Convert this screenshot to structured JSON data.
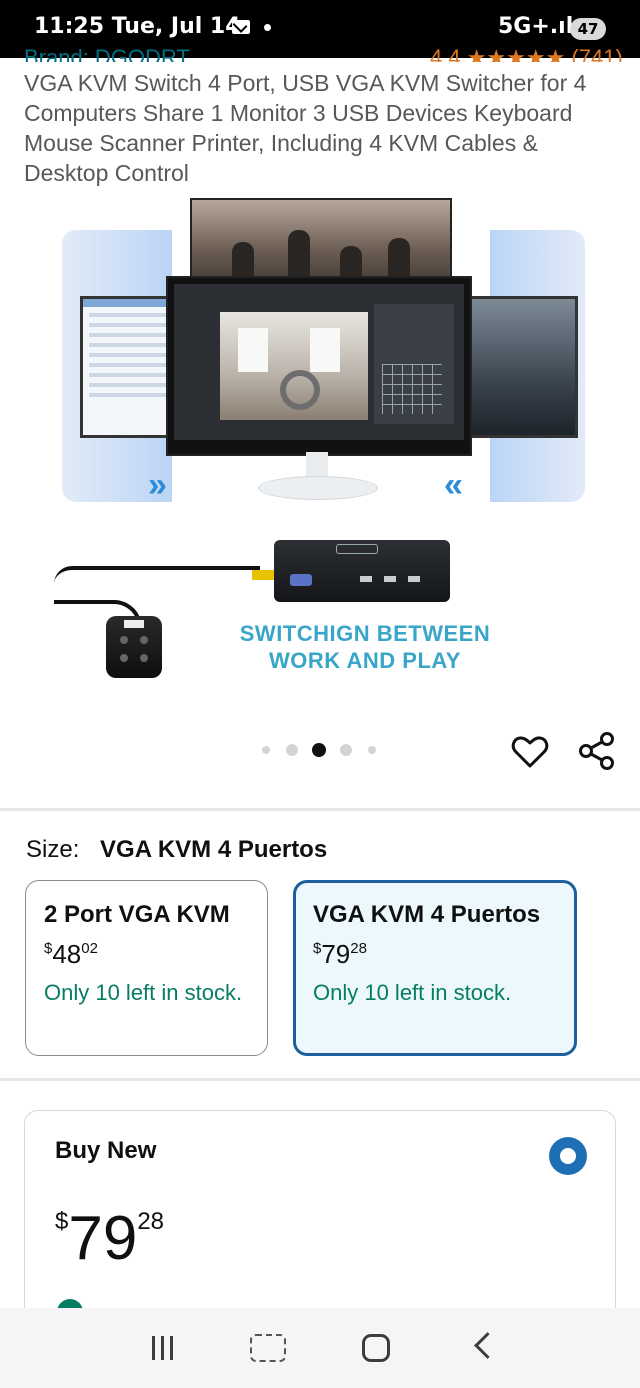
{
  "status_bar": {
    "time": "11:25 Tue, Jul 14",
    "network": "5G+.ıl",
    "battery": "47"
  },
  "header": {
    "brand_partial": "Brand: DGODRT",
    "rating_partial": "4.4 ★★★★★ (741)"
  },
  "product": {
    "title": "VGA KVM Switch 4 Port, USB VGA KVM Switcher for 4 Computers Share 1 Monitor 3 USB Devices Keyboard Mouse Scanner Printer, Including 4 KVM Cables & Desktop Control",
    "image_caption": "SWITCHIGN BETWEEN\nWORK AND PLAY",
    "image_count": 5,
    "active_image_index": 2
  },
  "icons": {
    "wishlist": "heart-icon",
    "share": "share-icon"
  },
  "size": {
    "label": "Size:",
    "selected": "VGA KVM 4 Puertos",
    "options": [
      {
        "name": "2 Port VGA KVM",
        "currency": "$",
        "whole": "48",
        "fraction": "02",
        "stock": "Only 10 left in stock."
      },
      {
        "name": "VGA KVM 4 Puertos",
        "currency": "$",
        "whole": "79",
        "fraction": "28",
        "stock": "Only 10 left in stock."
      }
    ]
  },
  "buy_new": {
    "title": "Buy New",
    "currency": "$",
    "whole": "79",
    "fraction": "28"
  },
  "colors": {
    "accent_blue": "#1f5e9e",
    "stock_green": "#067d62",
    "caption_teal": "#39a6c9",
    "link": "#007185"
  }
}
